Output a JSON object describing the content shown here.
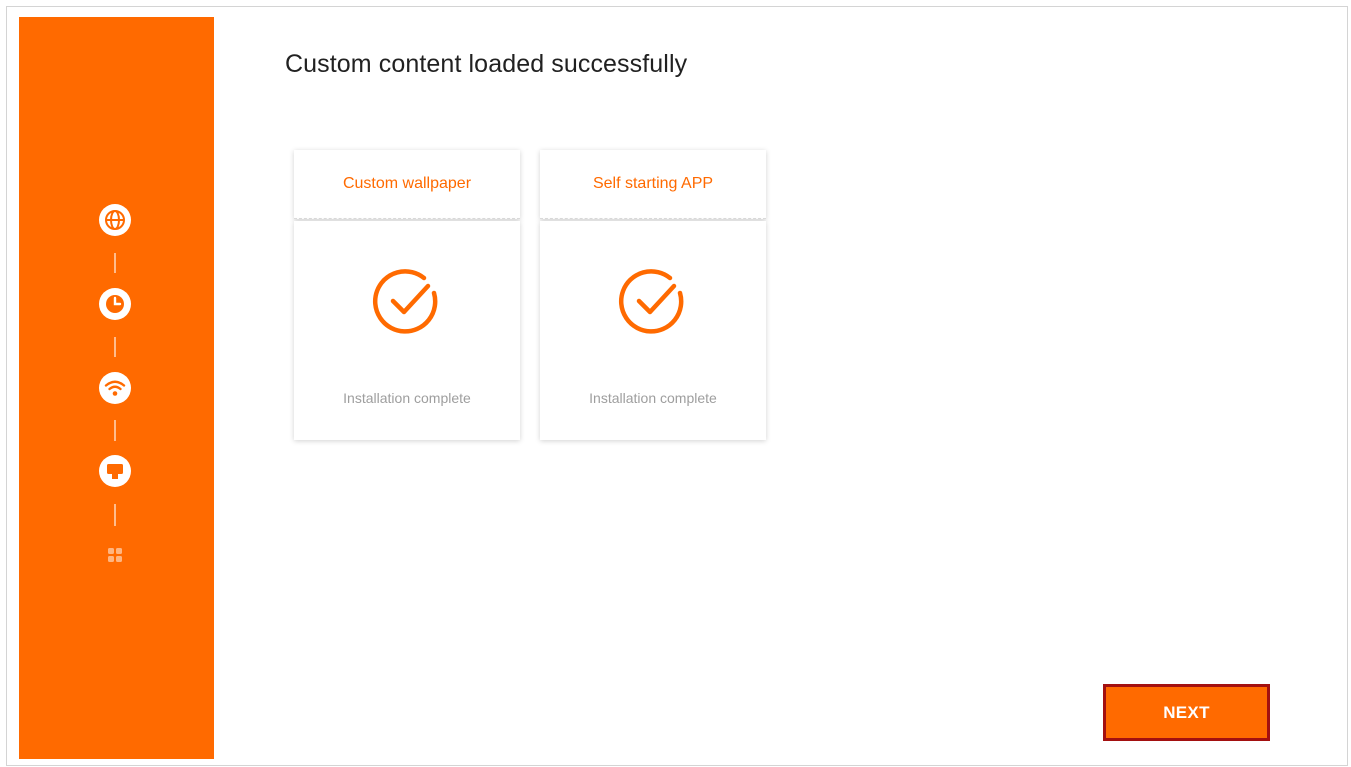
{
  "colors": {
    "accent": "#ff6a00",
    "button_border": "#a31010"
  },
  "header": {
    "title": "Custom content loaded successfully"
  },
  "steps": [
    {
      "icon": "globe-icon",
      "state": "complete"
    },
    {
      "icon": "clock-icon",
      "state": "complete"
    },
    {
      "icon": "wifi-icon",
      "state": "complete"
    },
    {
      "icon": "display-icon",
      "state": "current"
    },
    {
      "icon": "apps-grid-icon",
      "state": "pending"
    }
  ],
  "cards": [
    {
      "title": "Custom wallpaper",
      "status": "Installation complete",
      "icon": "check-circle-icon"
    },
    {
      "title": "Self starting APP",
      "status": "Installation complete",
      "icon": "check-circle-icon"
    }
  ],
  "footer": {
    "next_label": "NEXT"
  }
}
